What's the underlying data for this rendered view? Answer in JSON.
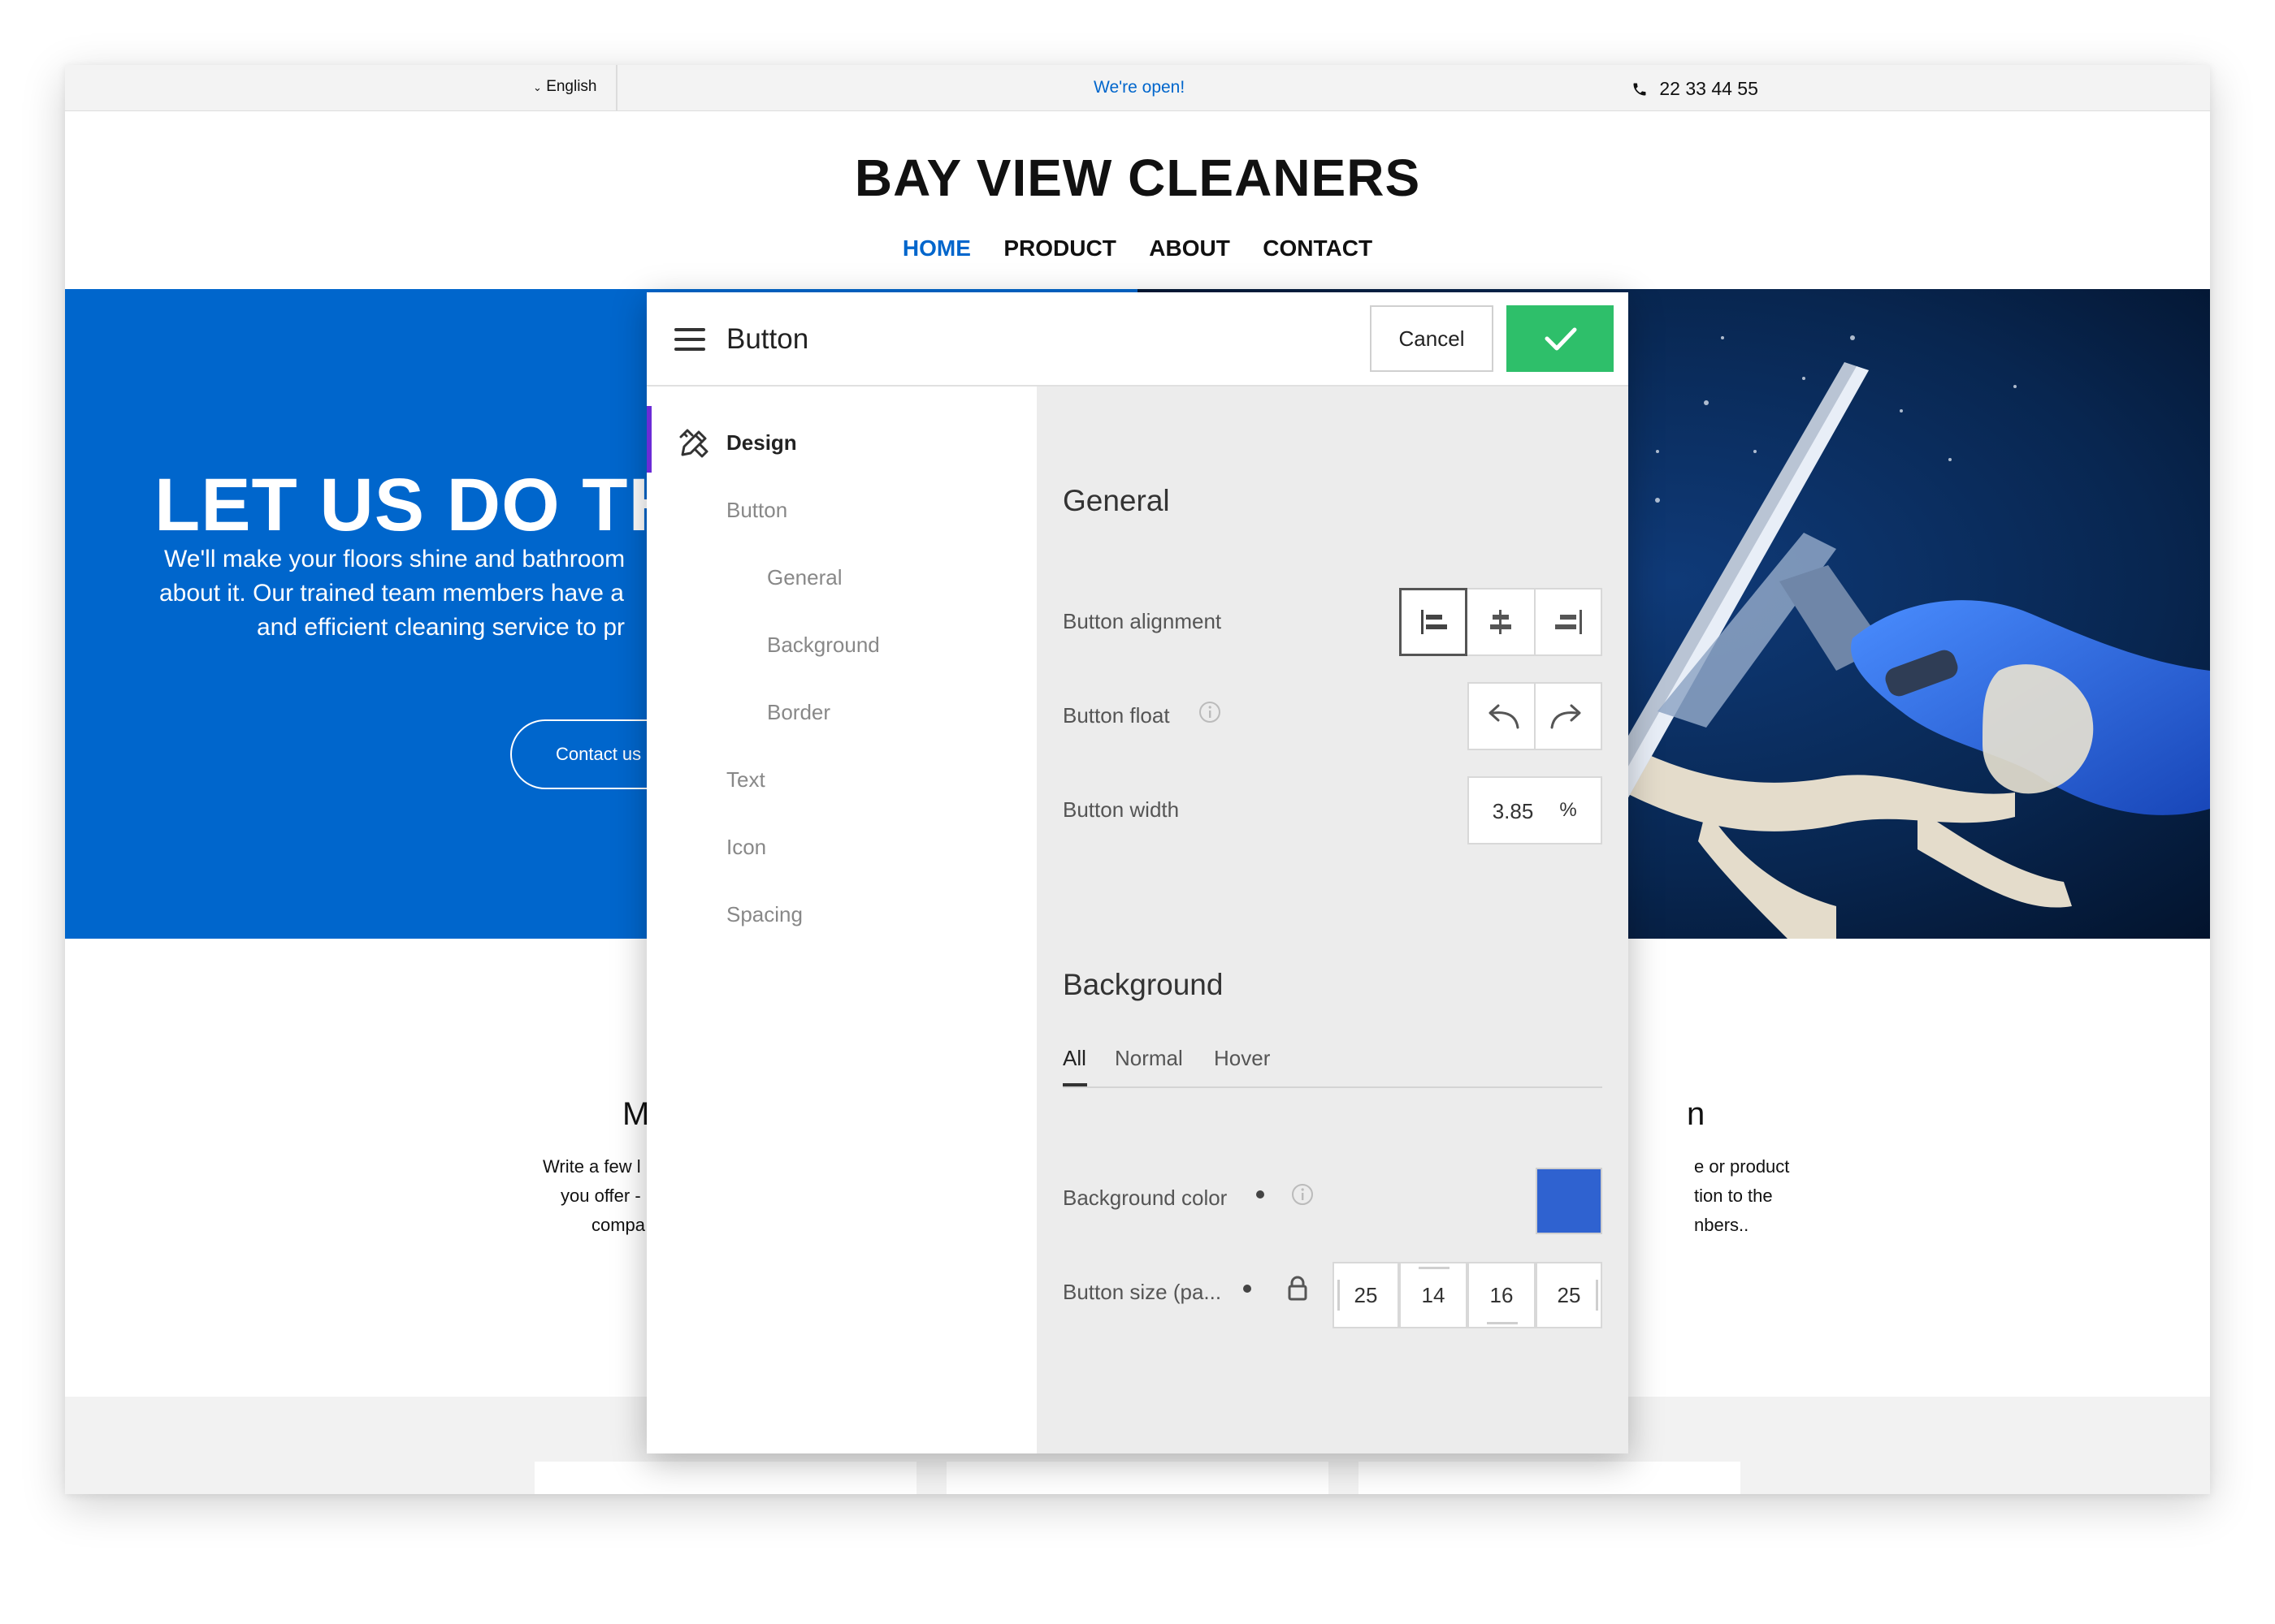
{
  "topbar": {
    "language": "English",
    "status": "We're open!",
    "phone": "22 33 44 55"
  },
  "site": {
    "brand": "BAY VIEW CLEANERS",
    "nav": [
      "HOME",
      "PRODUCT",
      "ABOUT",
      "CONTACT"
    ],
    "active_nav": "HOME"
  },
  "hero": {
    "title": "LET US DO THI",
    "lines": [
      "We'll make your floors shine and bathroom",
      "about it. Our trained team members have a",
      "and efficient cleaning service to pr"
    ],
    "button": "Contact us"
  },
  "features": {
    "title_left": "M",
    "title_right": "n",
    "left_lines": [
      "Write a few l",
      "you offer -",
      "compa"
    ],
    "right_lines": [
      "e or product",
      "tion to the",
      "nbers.."
    ]
  },
  "panel": {
    "title": "Button",
    "cancel": "Cancel",
    "sidebar": {
      "design": "Design",
      "items": [
        "Button",
        "General",
        "Background",
        "Border",
        "Text",
        "Icon",
        "Spacing"
      ]
    },
    "general": {
      "heading": "General",
      "alignment_label": "Button alignment",
      "alignment_selected": "left",
      "float_label": "Button float",
      "width_label": "Button width",
      "width_value": "3.85",
      "width_unit": "%"
    },
    "background": {
      "heading": "Background",
      "tabs": [
        "All",
        "Normal",
        "Hover"
      ],
      "active_tab": "All",
      "color_label": "Background color",
      "color_value": "#2f62d0",
      "size_label": "Button size (pa...",
      "size_values": [
        "25",
        "14",
        "16",
        "25"
      ]
    }
  },
  "colors": {
    "brand_blue": "#0066cc",
    "confirm_green": "#2ebf6a",
    "panel_accent": "#6b2bd6"
  }
}
